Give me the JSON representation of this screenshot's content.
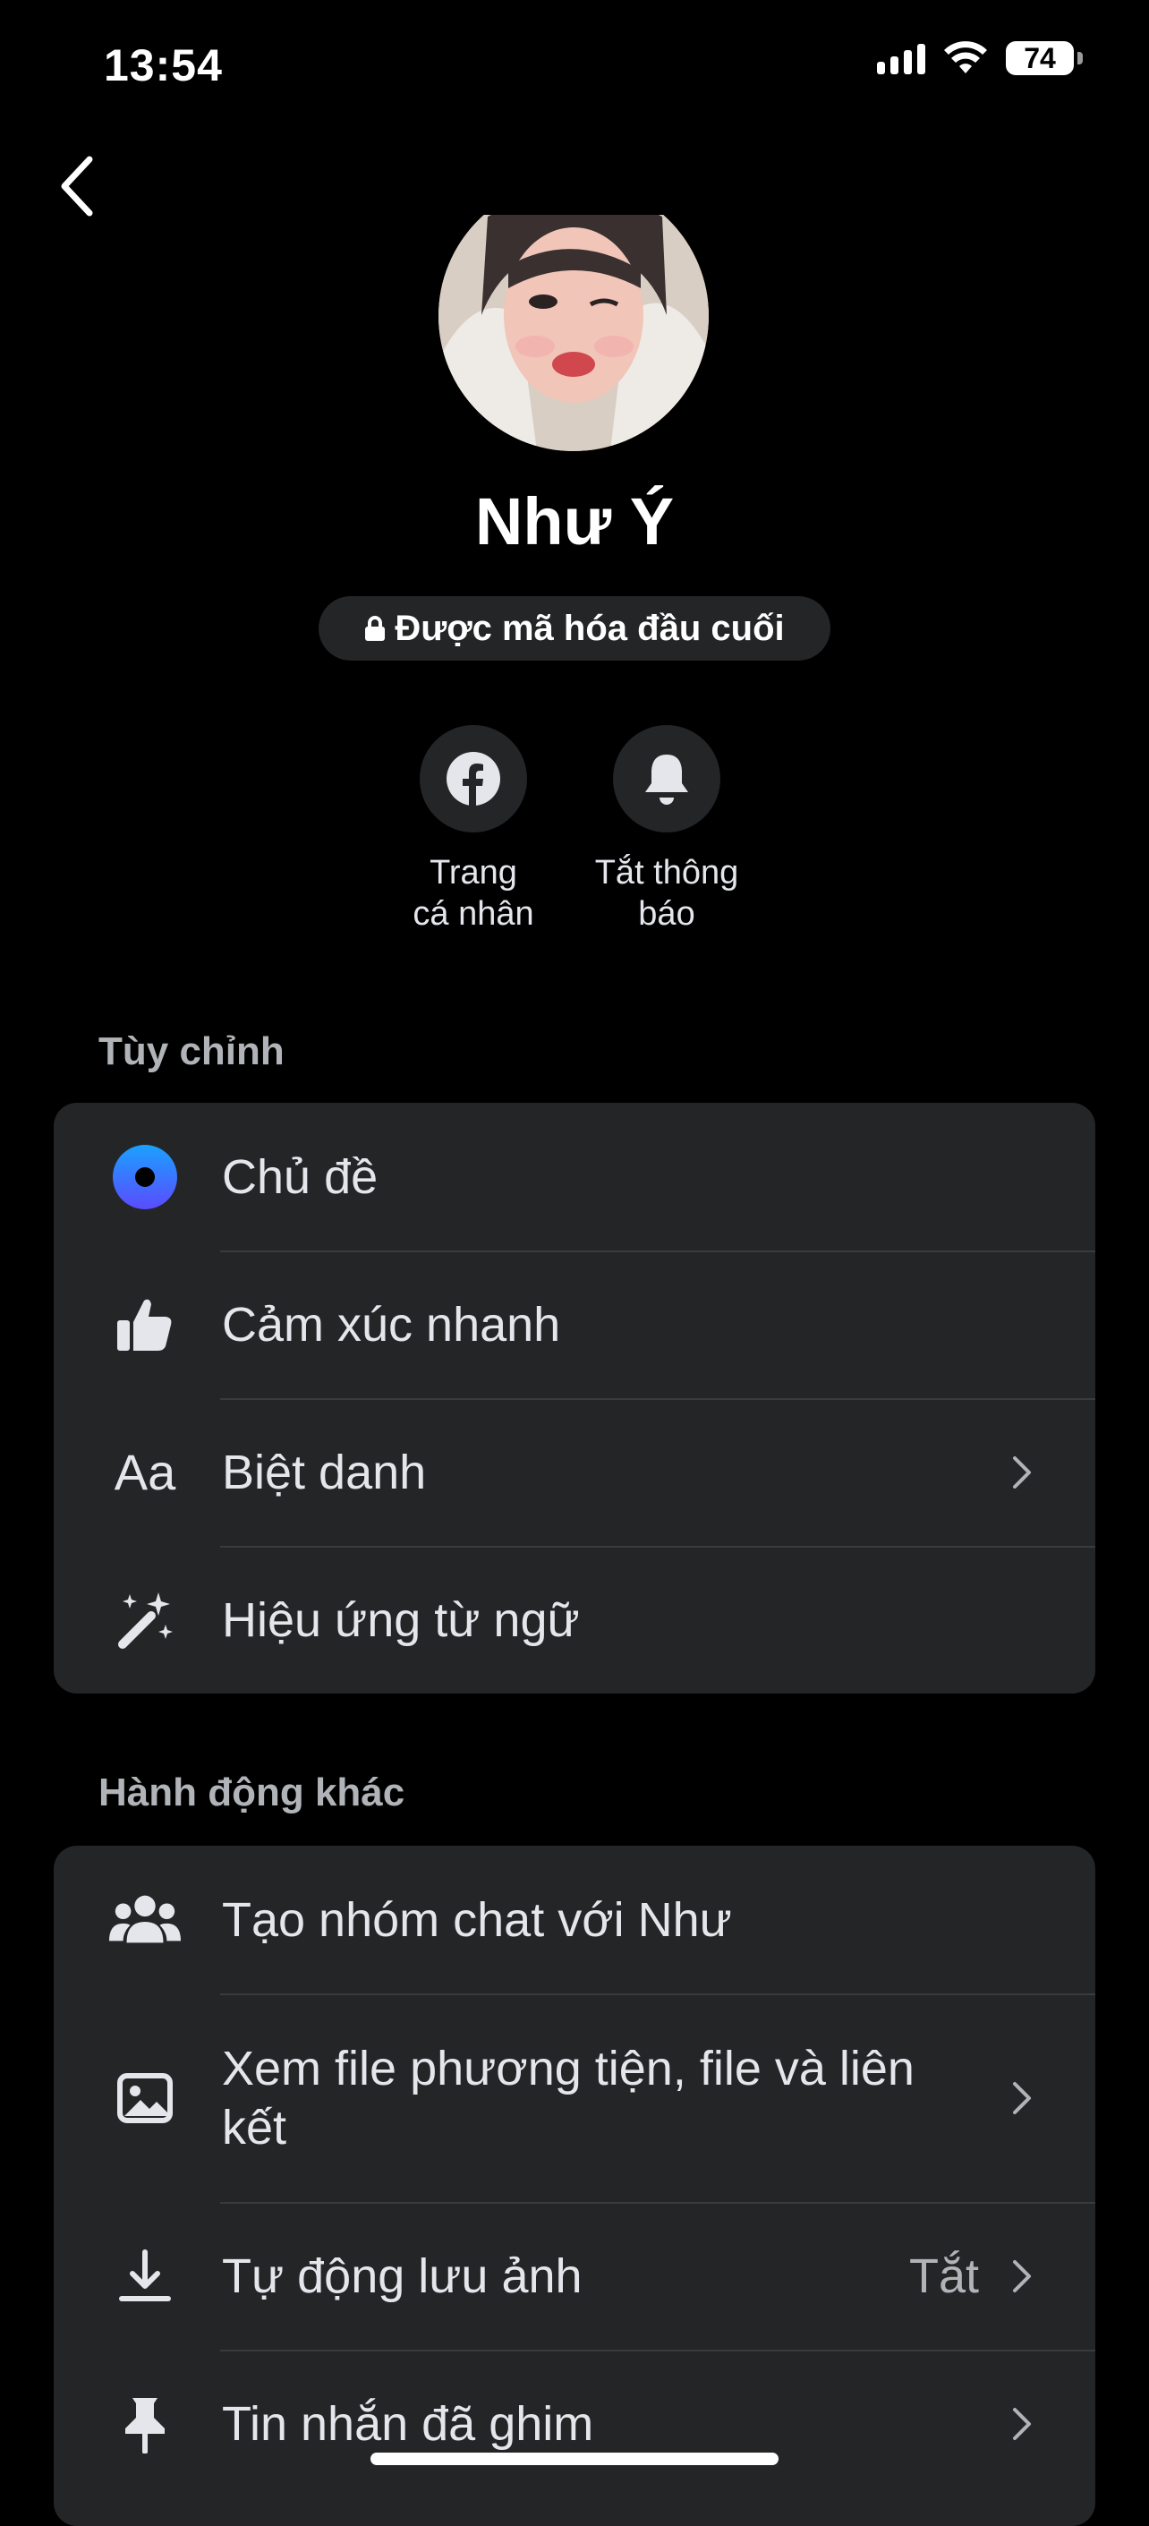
{
  "status": {
    "time": "13:54",
    "battery": "74"
  },
  "profile": {
    "name": "Như Ý",
    "encryption_badge": "Được mã hóa đầu cuối"
  },
  "quick_actions": [
    {
      "icon": "facebook-icon",
      "label_line1": "Trang",
      "label_line2": "cá nhân"
    },
    {
      "icon": "bell-icon",
      "label_line1": "Tắt thông",
      "label_line2": "báo"
    }
  ],
  "customize": {
    "title": "Tùy chỉnh",
    "items": [
      {
        "icon": "theme-icon",
        "label": "Chủ đề",
        "chevron": false
      },
      {
        "icon": "thumbs-up-icon",
        "label": "Cảm xúc nhanh",
        "chevron": false
      },
      {
        "icon": "nickname-icon",
        "icon_text": "Aa",
        "label": "Biệt danh",
        "chevron": true
      },
      {
        "icon": "sparkle-wand-icon",
        "label": "Hiệu ứng từ ngữ",
        "chevron": false
      }
    ]
  },
  "other_actions": {
    "title": "Hành động khác",
    "items": [
      {
        "icon": "group-icon",
        "label": "Tạo nhóm chat với Như",
        "chevron": false
      },
      {
        "icon": "image-icon",
        "label": "Xem file phương tiện, file và liên kết",
        "chevron": true
      },
      {
        "icon": "download-icon",
        "label": "Tự động lưu ảnh",
        "value": "Tắt",
        "chevron": true
      },
      {
        "icon": "pin-icon",
        "label": "Tin nhắn đã ghim",
        "chevron": true
      }
    ]
  },
  "colors": {
    "background": "#000000",
    "card": "#242526",
    "secondary_text": "#B0B3B8",
    "theme_accent": "#3E6CF5"
  }
}
